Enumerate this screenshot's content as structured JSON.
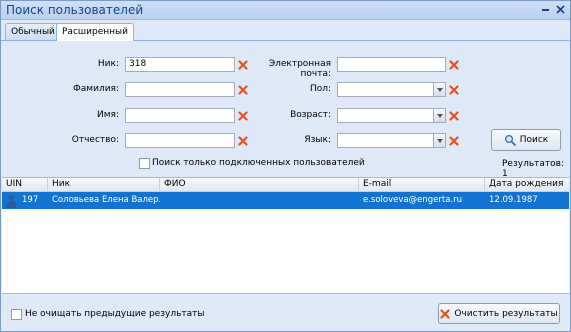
{
  "window": {
    "title": "Поиск пользователей"
  },
  "tabs": [
    {
      "label": "Обычный"
    },
    {
      "label": "Расширенный"
    }
  ],
  "form": {
    "nick_label": "Ник:",
    "nick_value": "318",
    "surname_label": "Фамилия:",
    "surname_value": "",
    "name_label": "Имя:",
    "name_value": "",
    "patronymic_label": "Отчество:",
    "patronymic_value": "",
    "email_label": "Электронная почта:",
    "email_value": "",
    "gender_label": "Пол:",
    "gender_value": "",
    "age_label": "Возраст:",
    "age_value": "",
    "language_label": "Язык:",
    "language_value": "",
    "online_only_label": "Поиск только подключенных пользователей",
    "online_only_checked": false,
    "search_button": "Поиск",
    "results_count": "Результатов: 1"
  },
  "results": {
    "columns": [
      "UIN",
      "Ник",
      "ФИО",
      "E-mail",
      "Дата рождения"
    ],
    "rows": [
      {
        "uin": "197",
        "nick": "Соловьева Елена Валер...",
        "fio": "",
        "email": "e.soloveva@engerta.ru",
        "birth": "12.09.1987",
        "icon": "user-icon",
        "selected": true
      }
    ]
  },
  "footer": {
    "keep_results_label": "Не очищать предыдущие результаты",
    "keep_results_checked": false,
    "clear_button": "Очистить результаты"
  },
  "colors": {
    "selection": "#1273d1",
    "title": "#15428b",
    "clear_icon": "#e2531f"
  }
}
